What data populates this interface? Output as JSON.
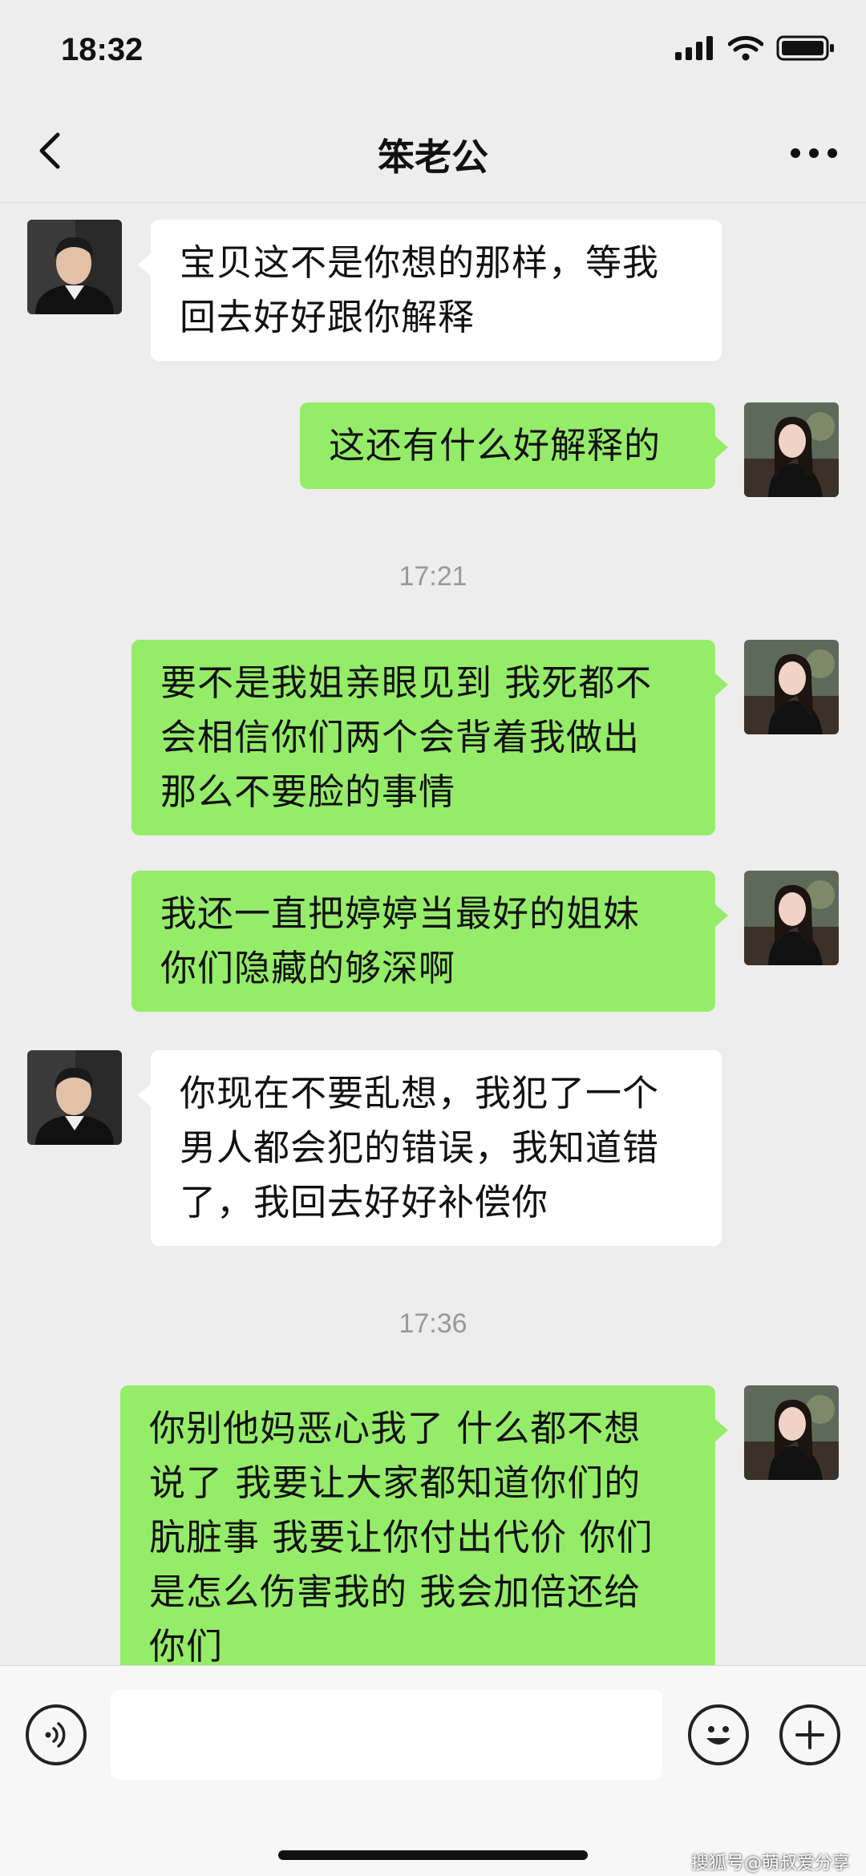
{
  "status_bar": {
    "time": "18:32"
  },
  "header": {
    "title": "笨老公"
  },
  "messages": {
    "m0": "宝贝这不是你想的那样，等我\n回去好好跟你解释",
    "m1": "这还有什么好解释的",
    "t1": "17:21",
    "m2": "要不是我姐亲眼见到 我死都不\n会相信你们两个会背着我做出\n那么不要脸的事情",
    "m3": "我还一直把婷婷当最好的姐妹\n你们隐藏的够深啊",
    "m4": "你现在不要乱想，我犯了一个\n男人都会犯的错误，我知道错\n了，我回去好好补偿你",
    "t2": "17:36",
    "m5": "你别他妈恶心我了 什么都不想\n说了 我要让大家都知道你们的\n肮脏事 我要让你付出代价 你们\n是怎么伤害我的 我会加倍还给\n你们"
  },
  "watermark": "搜狐号@萌叔爱分享",
  "colors": {
    "self_bubble": "#95ec69",
    "other_bubble": "#ffffff",
    "background": "#ededed"
  }
}
